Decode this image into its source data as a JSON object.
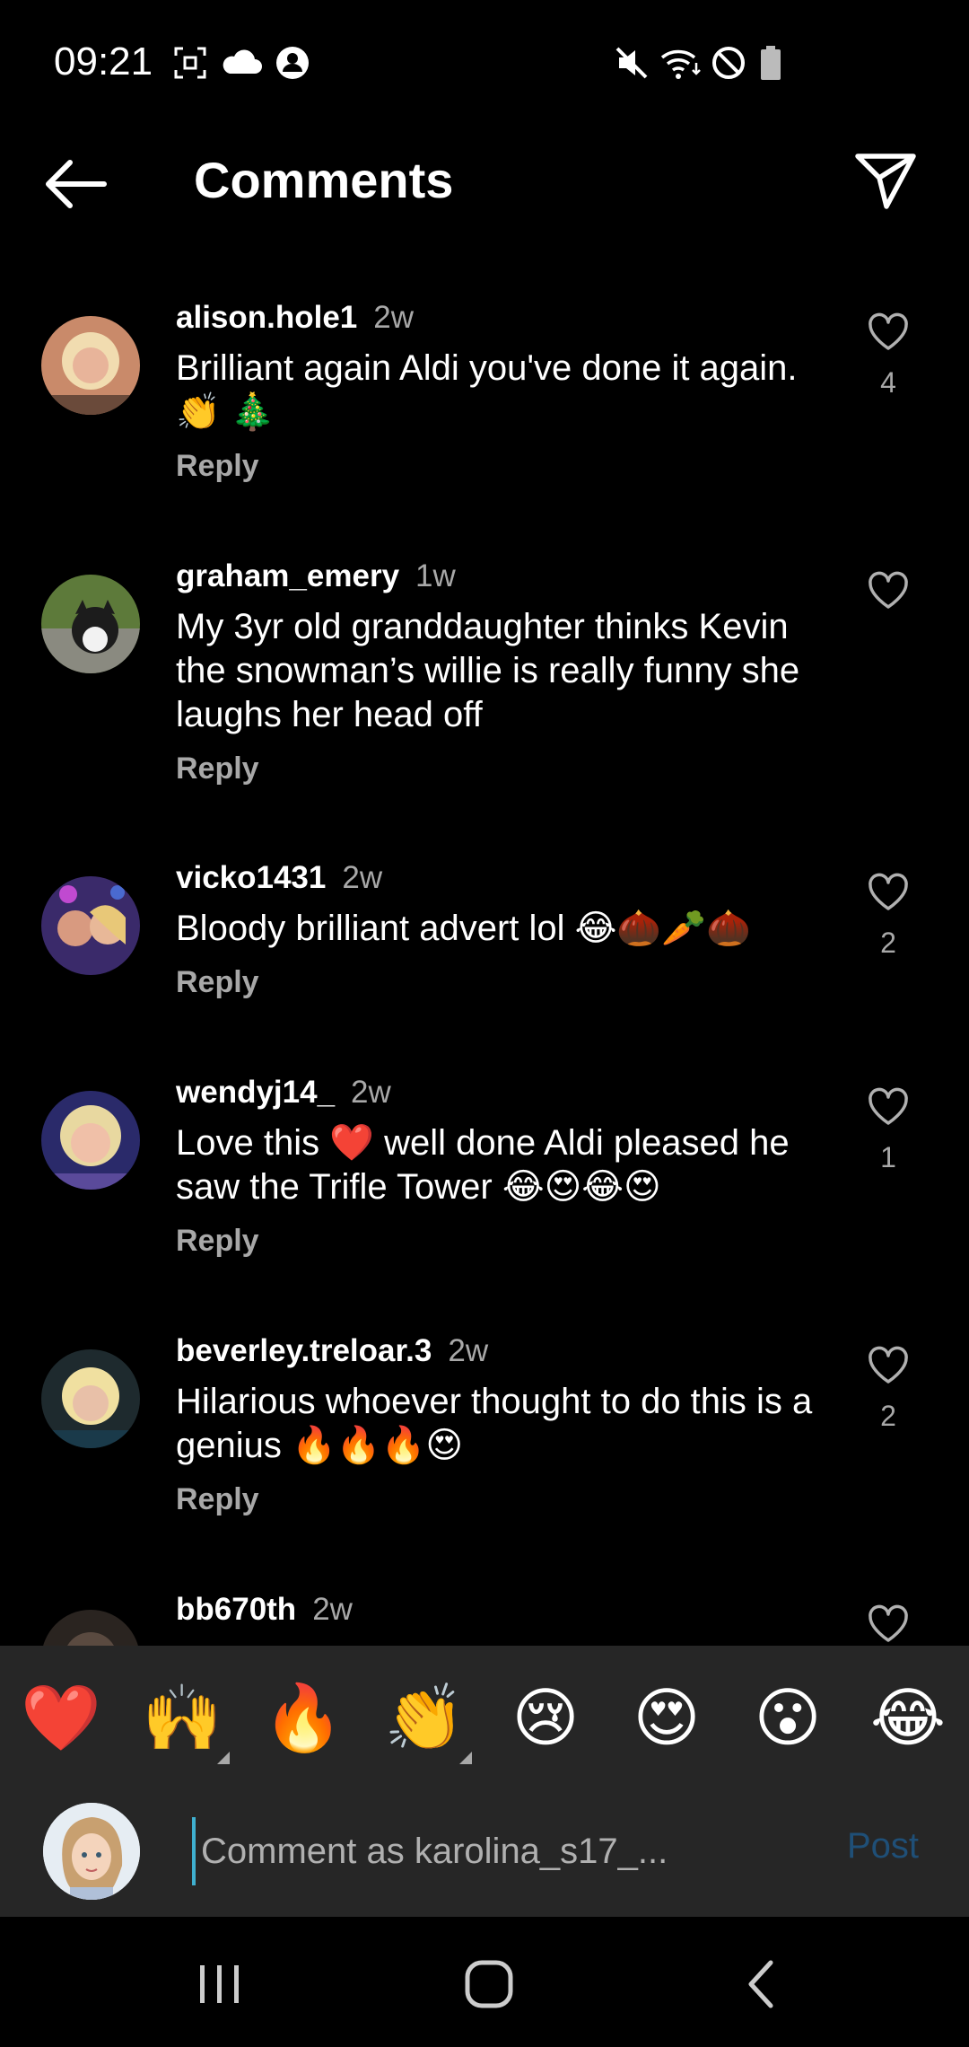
{
  "status_bar": {
    "time": "09:21",
    "left_icons": [
      "screenshot-icon",
      "cloud-icon",
      "account-icon"
    ],
    "right_icons": [
      "mute-icon",
      "wifi-icon",
      "do-not-disturb-icon",
      "battery-icon"
    ]
  },
  "header": {
    "title": "Comments",
    "back_icon": "arrow-left-icon",
    "share_icon": "paper-plane-icon"
  },
  "comments": [
    {
      "username": "alison.hole1",
      "time": "2w",
      "text": "Brilliant again Aldi you've done it again. 👏 🎄",
      "reply_label": "Reply",
      "likes": "4"
    },
    {
      "username": "graham_emery",
      "time": "1w",
      "text": "My 3yr old granddaughter thinks Kevin the snowman’s willie is really funny she laughs her head off",
      "reply_label": "Reply",
      "likes": ""
    },
    {
      "username": "vicko1431",
      "time": "2w",
      "text": "Bloody brilliant advert lol 😂🌰🥕🌰",
      "reply_label": "Reply",
      "likes": "2"
    },
    {
      "username": "wendyj14_",
      "time": "2w",
      "text": "Love this ❤️ well done Aldi pleased he saw the Trifle Tower 😂😍😂😍",
      "reply_label": "Reply",
      "likes": "1"
    },
    {
      "username": "beverley.treloar.3",
      "time": "2w",
      "text": "Hilarious whoever thought to do this is a genius 🔥🔥🔥😍",
      "reply_label": "Reply",
      "likes": "2"
    },
    {
      "username": "bb670th",
      "time": "2w",
      "text": "",
      "reply_label": "",
      "likes": ""
    }
  ],
  "emoji_bar": {
    "emojis": [
      "❤️",
      "🙌",
      "🔥",
      "👏",
      "😢",
      "😍",
      "😮",
      "😂"
    ]
  },
  "comment_input": {
    "placeholder": "Comment as karolina_s17_...",
    "post_label": "Post"
  },
  "nav_bar": {
    "icons": [
      "recent-apps-icon",
      "home-icon",
      "back-icon"
    ]
  },
  "colors": {
    "background": "#000000",
    "input_bar": "#262626",
    "secondary_text": "#a8a8a8",
    "post_disabled": "#1f4f77",
    "cursor": "#3fb0d0"
  }
}
